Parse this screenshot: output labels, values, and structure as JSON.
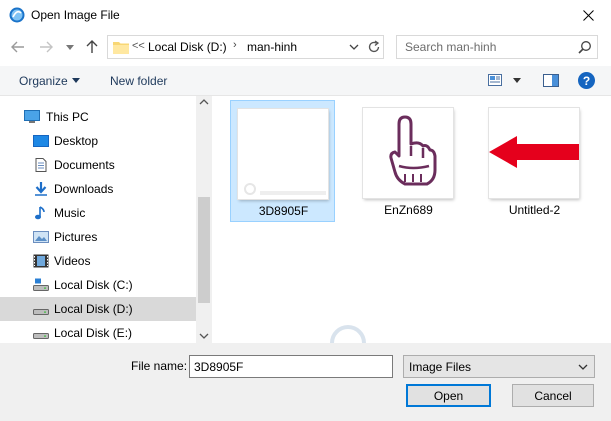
{
  "window": {
    "title": "Open Image File"
  },
  "address": {
    "overflow": "<<",
    "segments": [
      "Local Disk (D:)",
      "man-hinh"
    ]
  },
  "search": {
    "placeholder": "Search man-hinh"
  },
  "toolbar": {
    "organize": "Organize",
    "new_folder": "New folder"
  },
  "nav": {
    "items": [
      {
        "label": "This PC",
        "icon": "computer-icon"
      },
      {
        "label": "Desktop",
        "icon": "desktop-icon"
      },
      {
        "label": "Documents",
        "icon": "documents-icon"
      },
      {
        "label": "Downloads",
        "icon": "downloads-icon"
      },
      {
        "label": "Music",
        "icon": "music-icon"
      },
      {
        "label": "Pictures",
        "icon": "pictures-icon"
      },
      {
        "label": "Videos",
        "icon": "videos-icon"
      },
      {
        "label": "Local Disk (C:)",
        "icon": "drive-c-icon"
      },
      {
        "label": "Local Disk (D:)",
        "icon": "drive-icon",
        "selected": true
      },
      {
        "label": "Local Disk (E:)",
        "icon": "drive-icon"
      }
    ]
  },
  "files": [
    {
      "name": "3D8905F",
      "selected": true
    },
    {
      "name": "EnZn689"
    },
    {
      "name": "Untitled-2"
    }
  ],
  "filename": {
    "label": "File name:",
    "value": "3D8905F"
  },
  "filetype": {
    "value": "Image Files"
  },
  "buttons": {
    "open": "Open",
    "cancel": "Cancel"
  },
  "colors": {
    "accent": "#0078d7",
    "selection": "#cce8ff",
    "arrow_red": "#e5001c",
    "hand_purple": "#6b2d5c"
  }
}
